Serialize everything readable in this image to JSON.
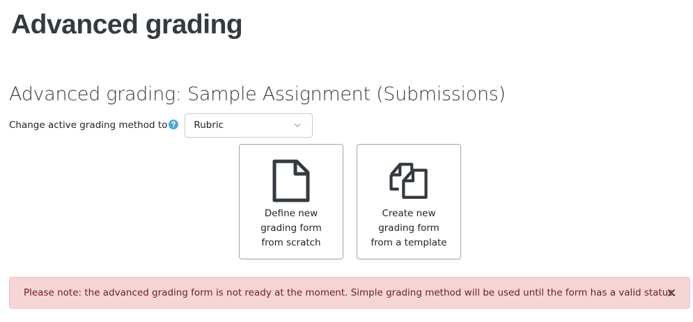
{
  "page": {
    "title": "Advanced grading"
  },
  "section": {
    "heading": "Advanced grading: Sample Assignment (Submissions)"
  },
  "method_selector": {
    "label": "Change active grading method to",
    "help_icon": "question-circle-icon",
    "selected_value": "Rubric",
    "chevron_icon": "chevron-down-icon"
  },
  "actions": [
    {
      "icon": "file-icon",
      "label_lines": [
        "Define new",
        "grading form",
        "from scratch"
      ]
    },
    {
      "icon": "copy-files-icon",
      "label_lines": [
        "Create new",
        "grading form",
        "from a template"
      ]
    }
  ],
  "alert": {
    "message": "Please note: the advanced grading form is not ready at the moment. Simple grading method will be used until the form has a valid status.",
    "close_icon": "close-icon"
  },
  "colors": {
    "help_icon": "#4fa6d3",
    "alert_background": "#f6d5d7",
    "alert_text": "#6e1d23",
    "card_border": "#9ea3a8",
    "icon_stroke": "#343a40"
  }
}
